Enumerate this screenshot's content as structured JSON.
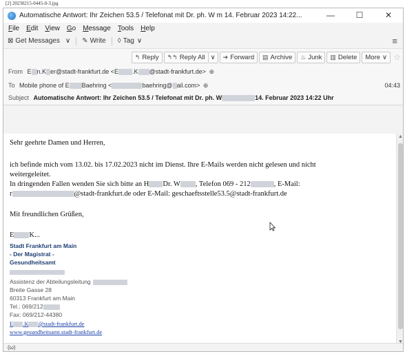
{
  "file_label": "[2] 20230215-0445-0-3.jpg",
  "window": {
    "title": "Automatische Antwort: Ihr Zeichen 53.5 / Telefonat mit Dr. ph. W          m 14. Februar 2023 14:22...",
    "controls": {
      "minimize": "—",
      "maximize": "☐",
      "close": "✕"
    }
  },
  "menu": [
    {
      "pre": "",
      "key": "F",
      "post": "ile"
    },
    {
      "pre": "",
      "key": "E",
      "post": "dit"
    },
    {
      "pre": "",
      "key": "V",
      "post": "iew"
    },
    {
      "pre": "",
      "key": "G",
      "post": "o"
    },
    {
      "pre": "",
      "key": "M",
      "post": "essage"
    },
    {
      "pre": "",
      "key": "T",
      "post": "ools"
    },
    {
      "pre": "",
      "key": "H",
      "post": "elp"
    }
  ],
  "toolbar": {
    "get_messages": "Get Messages",
    "write": "Write",
    "tag": "Tag",
    "menu_icon": "hamburger-menu-icon"
  },
  "actions": {
    "reply": "Reply",
    "reply_all": "Reply All",
    "forward": "Forward",
    "archive": "Archive",
    "junk": "Junk",
    "delete": "Delete",
    "more": "More"
  },
  "header": {
    "from_label": "From",
    "from_value_a": "E",
    "from_value_b": "n.K",
    "from_value_c": "er@stadt-frankfurt.de <E",
    "from_value_d": ".K",
    "from_value_e": "@stadt-frankfurt.de>",
    "to_label": "To",
    "to_value_a": "Mobile phone of E",
    "to_value_b": "Baehring <",
    "to_value_c": "baehring@",
    "to_value_d": "ail.com>",
    "time": "04:43",
    "subject_label": "Subject",
    "subject_a": "Automatische Antwort: Ihr Zeichen 53.5 / Telefonat mit Dr. ph. W",
    "subject_b": "14. Februar 2023 14:22 Uhr"
  },
  "body": {
    "greeting": "Sehr geehrte Damen und Herren,",
    "line1": "ich befinde mich vom 13.02. bis 17.02.2023 nicht im Dienst. Ihre E-Mails werden nicht gelesen und nicht",
    "line2": "weitergeleitet.",
    "line3a": "In dringenden Fallen wenden Sie sich bitte an H",
    "line3b": "Dr. W",
    "line3c": ", Telefon 069 - 212",
    "line3d": ", E-Mail:",
    "line4a": "r",
    "line4b": "@stadt-frankfurt.de oder E-Mail: geschaeftsstelle53.5@stadt-frankfurt.de",
    "closing": "Mit freundlichen Grüßen,",
    "sig_name_a": "E",
    "sig_name_b": "K...",
    "org1": "Stadt Frankfurt am Main",
    "org2": "- Der Magistrat -",
    "org3": "Gesundheitsamt",
    "assist": "Assistenz der Abteilungsleitung",
    "street": "Breite Gasse 28",
    "city": "60313 Frankfurt am Main",
    "tel": "Tel.: 069/212",
    "fax": "Fax: 069/212-44380",
    "email_a": "E",
    "email_b": ".K",
    "email_c": "@stadt-frankfurt.de",
    "website": "www.gesundheitsamt.stadt-frankfurt.de"
  },
  "status": "(ω)"
}
